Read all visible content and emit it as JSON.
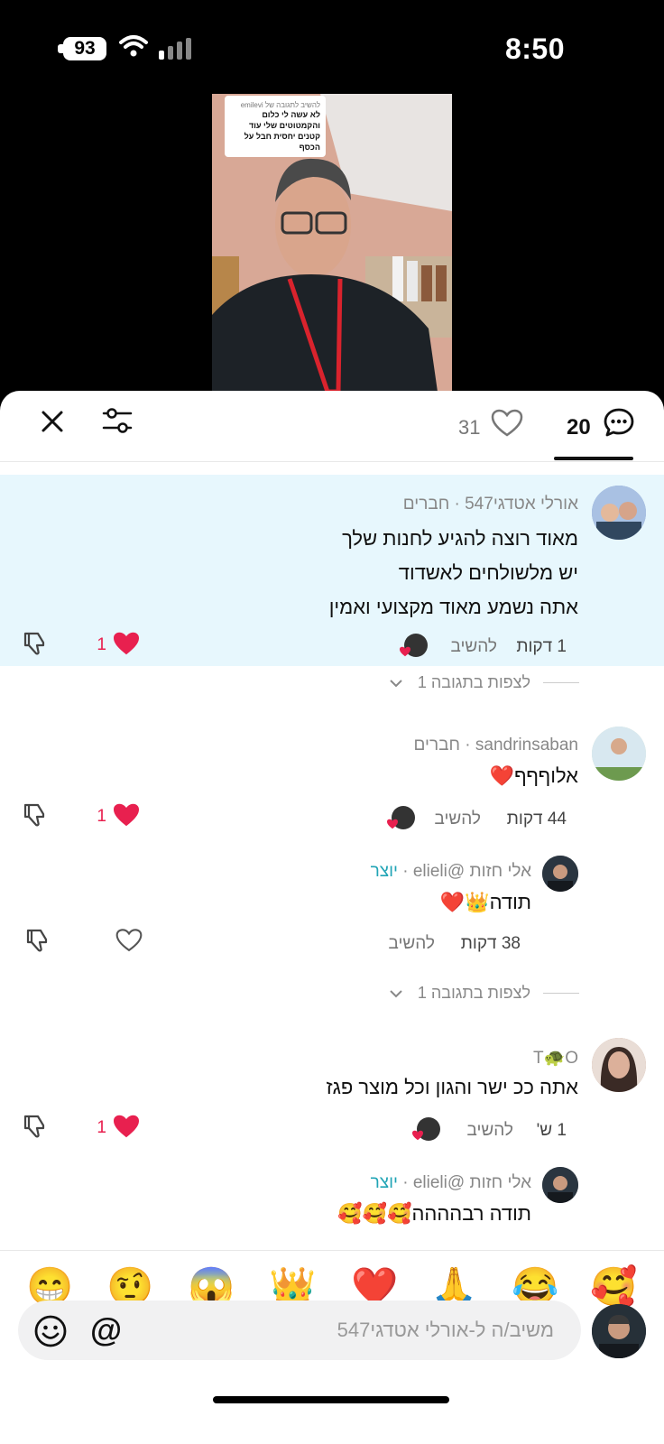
{
  "status_bar": {
    "battery": "93",
    "time": "8:50"
  },
  "video": {
    "sticker_header": "להשיב לתגובה של emilevi",
    "sticker_text": "לא עשה לי כלום והקמטוטים שלי עוד קטנים יחסית חבל על הכסף"
  },
  "sheet": {
    "likes_count": "31",
    "comments_count": "20"
  },
  "comments": [
    {
      "author": "אורלי אטדגי547",
      "tag": " · חברים",
      "lines": [
        "מאוד רוצה להגיע לחנות שלך",
        "יש מלשולחים לאשדוד",
        "אתה נשמע מאוד מקצועי ואמין"
      ],
      "time": "1 דקות",
      "reply_label": "להשיב",
      "likes": "1",
      "view_replies": "לצפות בתגובה 1"
    },
    {
      "author": "sandrinsaban",
      "tag": " · חברים",
      "text": "אלוףףף❤️",
      "time": "44 דקות",
      "reply_label": "להשיב",
      "likes": "1"
    },
    {
      "author": "אלי חזות @elieli",
      "tag": " · ",
      "creator_label": "יוצר",
      "text": "תודה👑❤️",
      "time": "38 דקות",
      "reply_label": "להשיב",
      "view_replies": "לצפות בתגובה 1"
    },
    {
      "author": "T🐢O",
      "text": "אתה ככ ישר והגון וכל מוצר פגז",
      "time": "1 ש'",
      "reply_label": "להשיב",
      "likes": "1"
    },
    {
      "author": "אלי חזות @elieli",
      "tag": " · ",
      "creator_label": "יוצר",
      "text": "תודה רבהההה🥰🥰🥰"
    }
  ],
  "emoji_bar": [
    "🥰",
    "😂",
    "🙏",
    "❤️",
    "👑",
    "😱",
    "🤨",
    "😁"
  ],
  "input": {
    "placeholder": "משיב/ה ל-אורלי אטדגי547"
  },
  "colors": {
    "highlight": "#e7f7fd",
    "heart": "#e8204f",
    "creator": "#20a4b5"
  }
}
